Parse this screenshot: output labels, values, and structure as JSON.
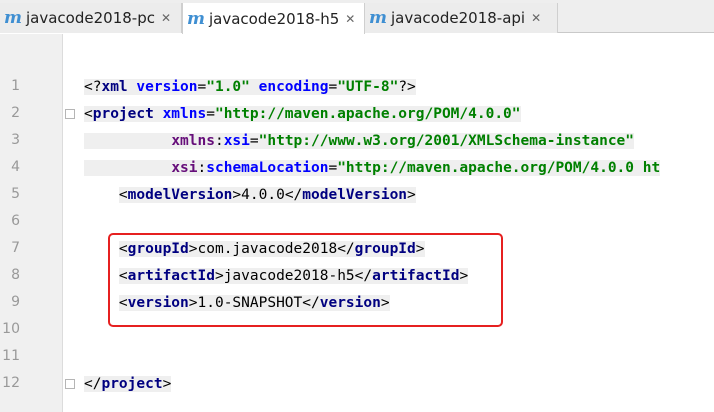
{
  "tabs": [
    {
      "label": "javacode2018-pc",
      "icon": "m"
    },
    {
      "label": "javacode2018-h5",
      "icon": "m"
    },
    {
      "label": "javacode2018-api",
      "icon": "m"
    }
  ],
  "line_numbers": [
    "1",
    "2",
    "3",
    "4",
    "5",
    "6",
    "7",
    "8",
    "9",
    "10",
    "11",
    "12"
  ],
  "code": {
    "l1": {
      "open": "<?",
      "tag": "xml ",
      "a1": "version",
      "eq1": "=",
      "v1": "\"1.0\"",
      "a2": " encoding",
      "eq2": "=",
      "v2": "\"UTF-8\"",
      "close": "?>"
    },
    "l2": {
      "open": "<",
      "tag": "project ",
      "a1": "xmlns",
      "eq1": "=",
      "v1": "\"http://maven.apache.org/POM/4.0.0\""
    },
    "l3": {
      "ns": "xmlns",
      "colon": ":",
      "a1": "xsi",
      "eq1": "=",
      "v1": "\"http://www.w3.org/2001/XMLSchema-instance\""
    },
    "l4": {
      "ns": "xsi",
      "colon": ":",
      "a1": "schemaLocation",
      "eq1": "=",
      "v1": "\"http://maven.apache.org/POM/4.0.0 ht"
    },
    "l5": {
      "open": "<",
      "tag": "modelVersion",
      "gt": ">",
      "text": "4.0.0",
      "close_open": "</",
      "close_tag": "modelVersion",
      "close_gt": ">"
    },
    "l7": {
      "open": "<",
      "tag": "groupId",
      "gt": ">",
      "text": "com.javacode2018",
      "close_open": "</",
      "close_tag": "groupId",
      "close_gt": ">"
    },
    "l8": {
      "open": "<",
      "tag": "artifactId",
      "gt": ">",
      "text": "javacode2018-h5",
      "close_open": "</",
      "close_tag": "artifactId",
      "close_gt": ">"
    },
    "l9": {
      "open": "<",
      "tag": "version",
      "gt": ">",
      "text": "1.0-SNAPSHOT",
      "close_open": "</",
      "close_tag": "version",
      "close_gt": ">"
    },
    "l12": {
      "close_open": "</",
      "close_tag": "project",
      "close_gt": ">"
    }
  },
  "colors": {
    "highlight_box": "#e62020",
    "tag": "#000080",
    "attribute": "#0000ff",
    "string": "#008000",
    "namespace": "#660e7a"
  }
}
